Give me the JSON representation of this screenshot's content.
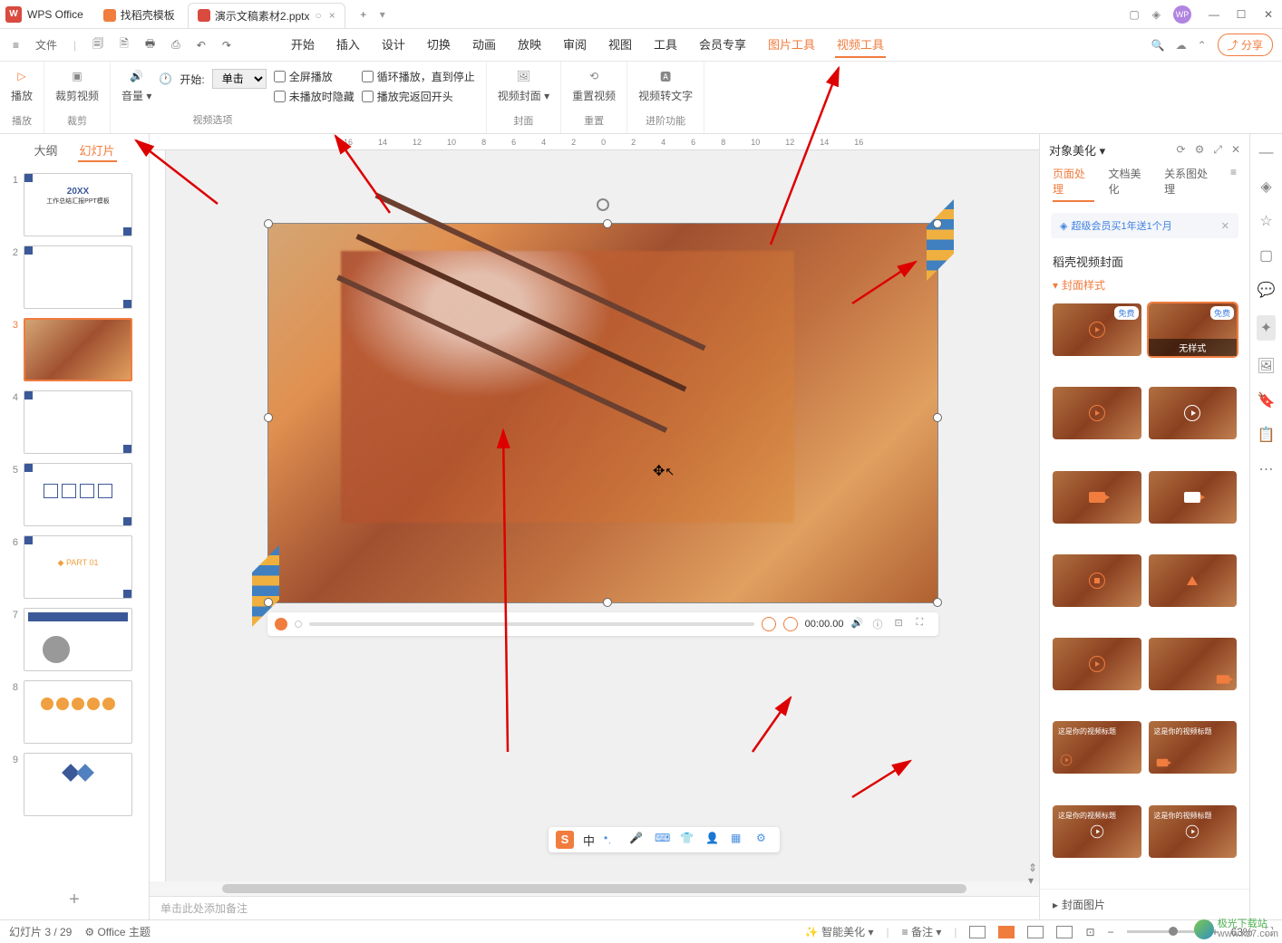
{
  "app": {
    "name": "WPS Office"
  },
  "tabs": [
    {
      "label": "找稻壳模板",
      "icon": "orange"
    },
    {
      "label": "演示文稿素材2.pptx",
      "icon": "red",
      "active": true
    }
  ],
  "menubar": {
    "file": "文件",
    "items": [
      "开始",
      "插入",
      "设计",
      "切换",
      "动画",
      "放映",
      "审阅",
      "视图",
      "工具",
      "会员专享"
    ],
    "context_items": [
      "图片工具",
      "视频工具"
    ],
    "active": "视频工具",
    "share": "分享"
  },
  "ribbon": {
    "play": "播放",
    "play_group": "播放",
    "trim": "裁剪视频",
    "trim_group": "裁剪",
    "volume": "音量",
    "start_label": "开始:",
    "start_value": "单击",
    "fullscreen": "全屏播放",
    "loop": "循环播放，直到停止",
    "hide": "未播放时隐藏",
    "rewind": "播放完返回开头",
    "options_group": "视频选项",
    "cover": "视频封面",
    "cover_group": "封面",
    "reset": "重置视频",
    "reset_group": "重置",
    "totext": "视频转文字",
    "advanced_group": "进阶功能"
  },
  "left_panel": {
    "tab_outline": "大纲",
    "tab_slides": "幻灯片",
    "slide_count": 9,
    "selected": 3,
    "thumb1_title": "20XX",
    "thumb1_sub": "工作总结汇报PPT模板"
  },
  "ruler_marks": [
    "16",
    "14",
    "12",
    "10",
    "8",
    "6",
    "4",
    "2",
    "0",
    "2",
    "4",
    "6",
    "8",
    "10",
    "12",
    "14",
    "16"
  ],
  "video_controls": {
    "time": "00:00.00"
  },
  "notes": {
    "placeholder": "单击此处添加备注"
  },
  "right_panel": {
    "title": "对象美化",
    "tabs": [
      "页面处理",
      "文档美化",
      "关系图处理"
    ],
    "active_tab": "页面处理",
    "promo": "超级会员买1年送1个月",
    "section": "稻壳视频封面",
    "accordion_open": "封面样式",
    "accordion_closed": "封面图片",
    "badge_free": "免费",
    "no_style": "无样式",
    "sample_title": "这是你的视频标题"
  },
  "statusbar": {
    "slide_pos": "幻灯片 3 / 29",
    "theme": "Office 主题",
    "smart_beauty": "智能美化",
    "notes": "备注",
    "zoom": "63%"
  },
  "float_toolbar": {
    "lang": "中"
  },
  "watermark": {
    "line1": "极光下载站",
    "line2": "www.xz7.com"
  }
}
